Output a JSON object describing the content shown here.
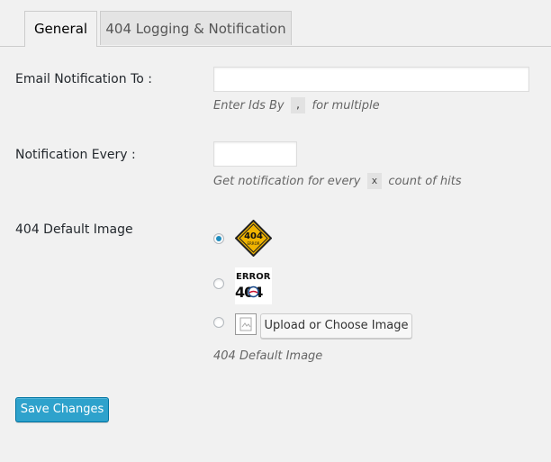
{
  "tabs": [
    {
      "label": "General",
      "active": true
    },
    {
      "label": "404 Logging & Notification",
      "active": false
    }
  ],
  "email_notification": {
    "label": "Email Notification To :",
    "value": "",
    "placeholder": "",
    "description_before": "Enter Ids By",
    "description_code": ",",
    "description_after": "for multiple"
  },
  "notification_every": {
    "label": "Notification Every :",
    "value": "",
    "placeholder": "",
    "description_before": "Get notification for every",
    "description_code": "x",
    "description_after": "count of hits"
  },
  "default_image": {
    "label": "404 Default Image",
    "options": [
      {
        "name": "404-error-sign-image",
        "checked": true
      },
      {
        "name": "error-404-image",
        "checked": false,
        "text_top": "ERROR",
        "text_bottom": "404"
      },
      {
        "name": "custom-image",
        "checked": false
      }
    ],
    "upload_button_label": "Upload or Choose Image",
    "description": "404 Default Image"
  },
  "sign_text": {
    "line1": "404",
    "line2": "ERROR"
  },
  "save_button_label": "Save Changes",
  "colors": {
    "primary_button": "#2ea2cc",
    "radio_checked": "#1e8cbe",
    "sign_yellow": "#f0b400"
  }
}
